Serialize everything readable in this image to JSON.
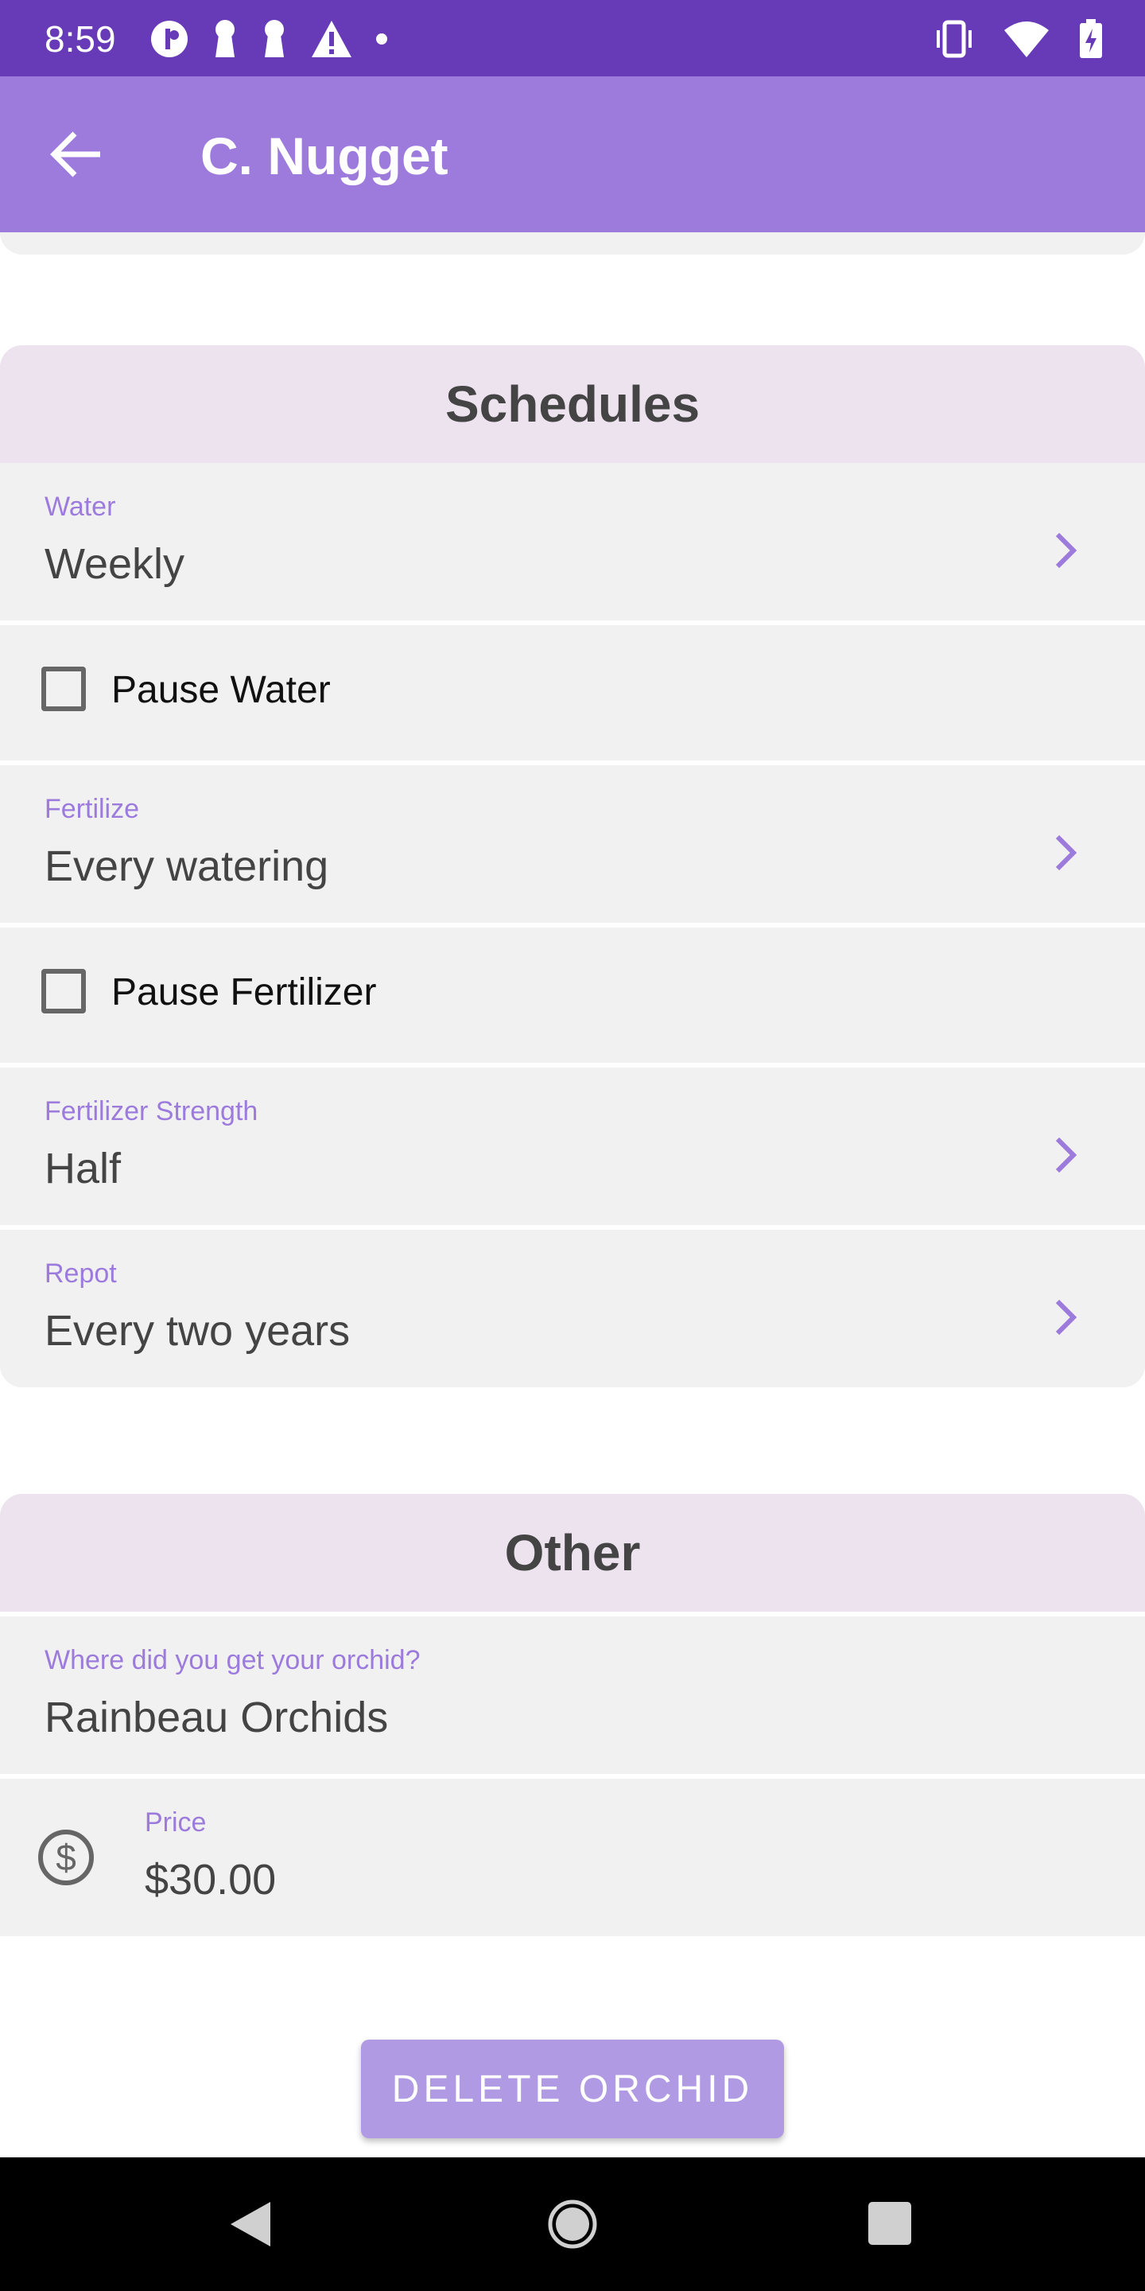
{
  "status_bar": {
    "time": "8:59"
  },
  "app_bar": {
    "title": "C. Nugget"
  },
  "schedules": {
    "heading": "Schedules",
    "water": {
      "label": "Water",
      "value": "Weekly"
    },
    "pause_water": {
      "label": "Pause Water",
      "checked": false
    },
    "fertilize": {
      "label": "Fertilize",
      "value": "Every watering"
    },
    "pause_fertilizer": {
      "label": "Pause Fertilizer",
      "checked": false
    },
    "fertilizer_strength": {
      "label": "Fertilizer Strength",
      "value": "Half"
    },
    "repot": {
      "label": "Repot",
      "value": "Every two years"
    }
  },
  "other": {
    "heading": "Other",
    "source": {
      "label": "Where did you get your orchid?",
      "value": "Rainbeau Orchids"
    },
    "price": {
      "label": "Price",
      "value": "$30.00"
    }
  },
  "actions": {
    "delete_label": "DELETE ORCHID"
  },
  "colors": {
    "status_bar": "#673ab7",
    "app_bar": "#9c7bdd",
    "accent": "#9c7bdd",
    "card_header": "#ede3ef",
    "card": "#f1f1f1",
    "button": "#b19ae4"
  }
}
